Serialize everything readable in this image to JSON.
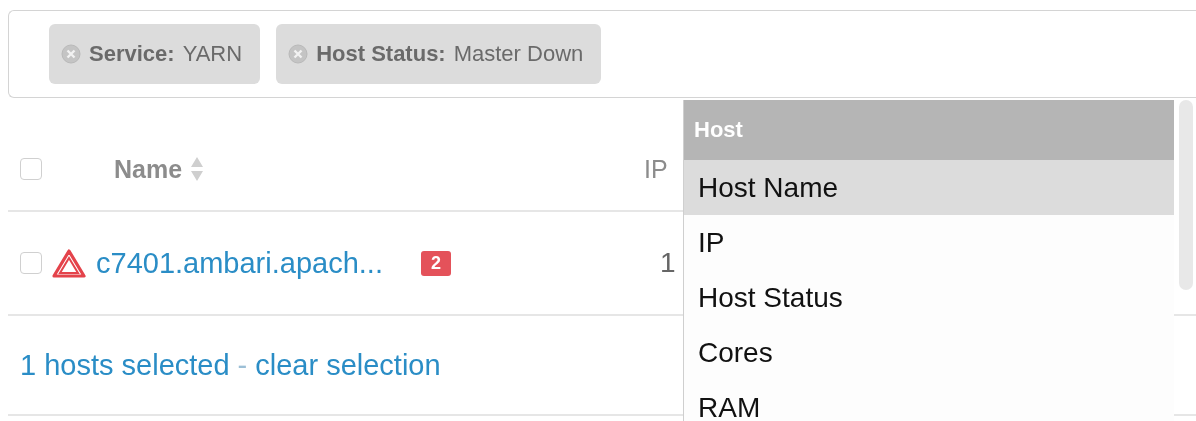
{
  "filters": [
    {
      "label": "Service:",
      "value": "YARN"
    },
    {
      "label": "Host Status:",
      "value": "Master Down"
    }
  ],
  "table": {
    "header_checked": false,
    "columns": [
      {
        "label": "Name"
      },
      {
        "label": "IP"
      }
    ],
    "rows": [
      {
        "checked": false,
        "warning": true,
        "name": "c7401.ambari.apach...",
        "alerts": "2",
        "ip": "1"
      }
    ]
  },
  "selection": {
    "count_text": "1 hosts selected",
    "separator": "-",
    "clear_link": "clear selection"
  },
  "column_menu": {
    "group": "Host",
    "items": [
      {
        "label": "Host Name",
        "selected": true
      },
      {
        "label": "IP",
        "selected": false
      },
      {
        "label": "Host Status",
        "selected": false
      },
      {
        "label": "Cores",
        "selected": false
      },
      {
        "label": "RAM",
        "selected": false
      }
    ]
  }
}
